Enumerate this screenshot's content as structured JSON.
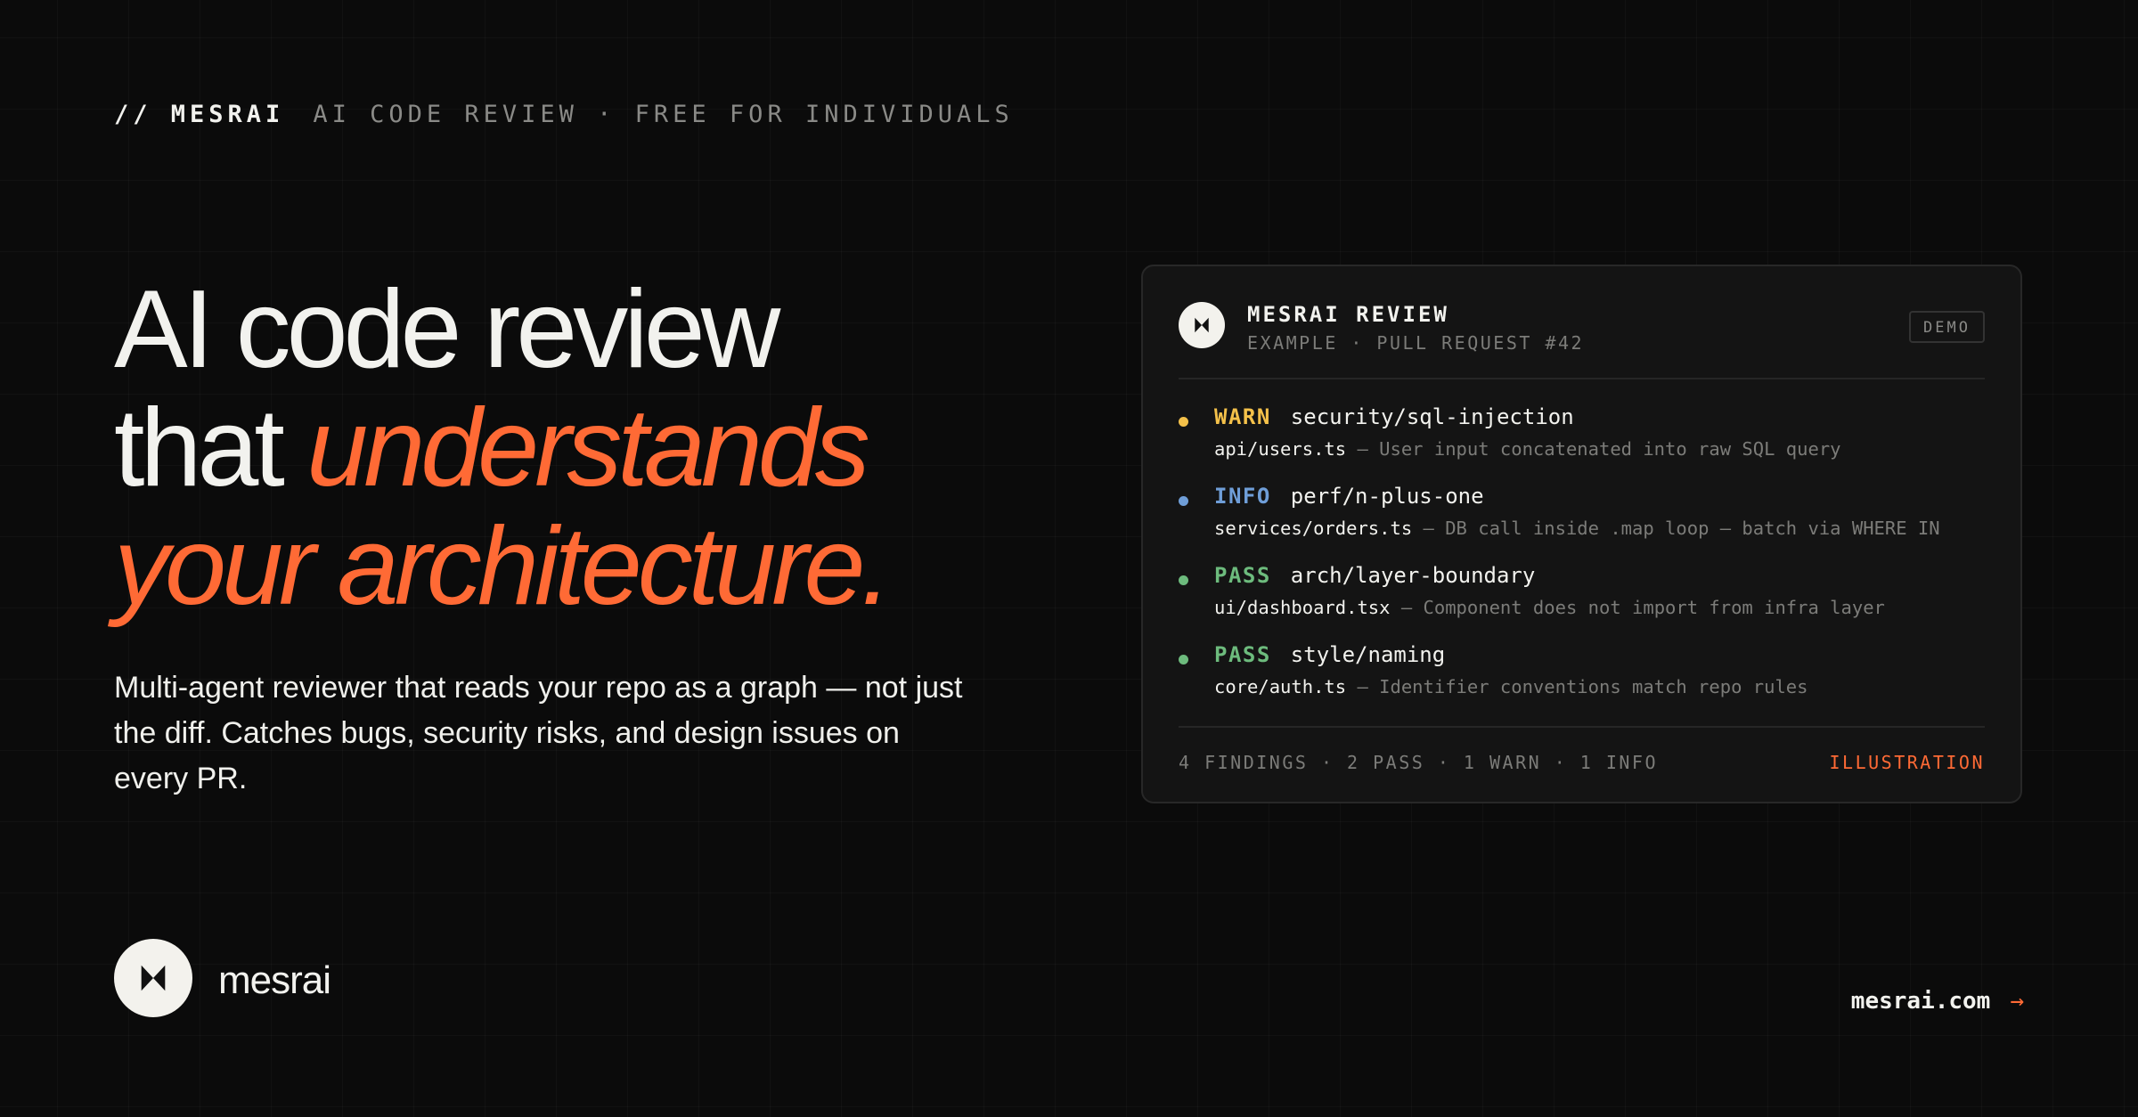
{
  "header": {
    "brand": "// MESRAI",
    "tagline": "AI CODE REVIEW · FREE FOR INDIVIDUALS"
  },
  "hero": {
    "line1": "AI code review",
    "line2_plain": "that ",
    "line2_accent": "understands",
    "line3_accent": "your architecture.",
    "subtitle": "Multi-agent reviewer that reads your repo as a graph — not just the diff. Catches bugs, security risks, and design issues on every PR."
  },
  "review_card": {
    "title": "MESRAI REVIEW",
    "subtitle": "EXAMPLE · PULL REQUEST #42",
    "badge": "DEMO",
    "findings": [
      {
        "status": "WARN",
        "rule": "security/sql-injection",
        "file": "api/users.ts",
        "message": " — User input concatenated into raw SQL query",
        "color": "#f4c14a"
      },
      {
        "status": "INFO",
        "rule": "perf/n-plus-one",
        "file": "services/orders.ts",
        "message": " — DB call inside .map loop — batch via WHERE IN",
        "color": "#6f9ed8"
      },
      {
        "status": "PASS",
        "rule": "arch/layer-boundary",
        "file": "ui/dashboard.tsx",
        "message": " — Component does not import from infra layer",
        "color": "#6dbb7d"
      },
      {
        "status": "PASS",
        "rule": "style/naming",
        "file": "core/auth.ts",
        "message": " — Identifier conventions match repo rules",
        "color": "#6dbb7d"
      }
    ],
    "summary": "4 FINDINGS · 2 PASS · 1 WARN · 1 INFO",
    "footer_label": "ILLUSTRATION"
  },
  "footer": {
    "logo_text": "mesrai",
    "link_text": "mesrai.com",
    "link_arrow": "→"
  },
  "colors": {
    "background": "#0b0b0b",
    "accent": "#ff6a35",
    "text": "#f2f2ee",
    "muted": "#7c7c79",
    "warn": "#f4c14a",
    "info": "#6f9ed8",
    "pass": "#6dbb7d"
  },
  "icons": {
    "logo": "mesrai-logo-icon"
  }
}
